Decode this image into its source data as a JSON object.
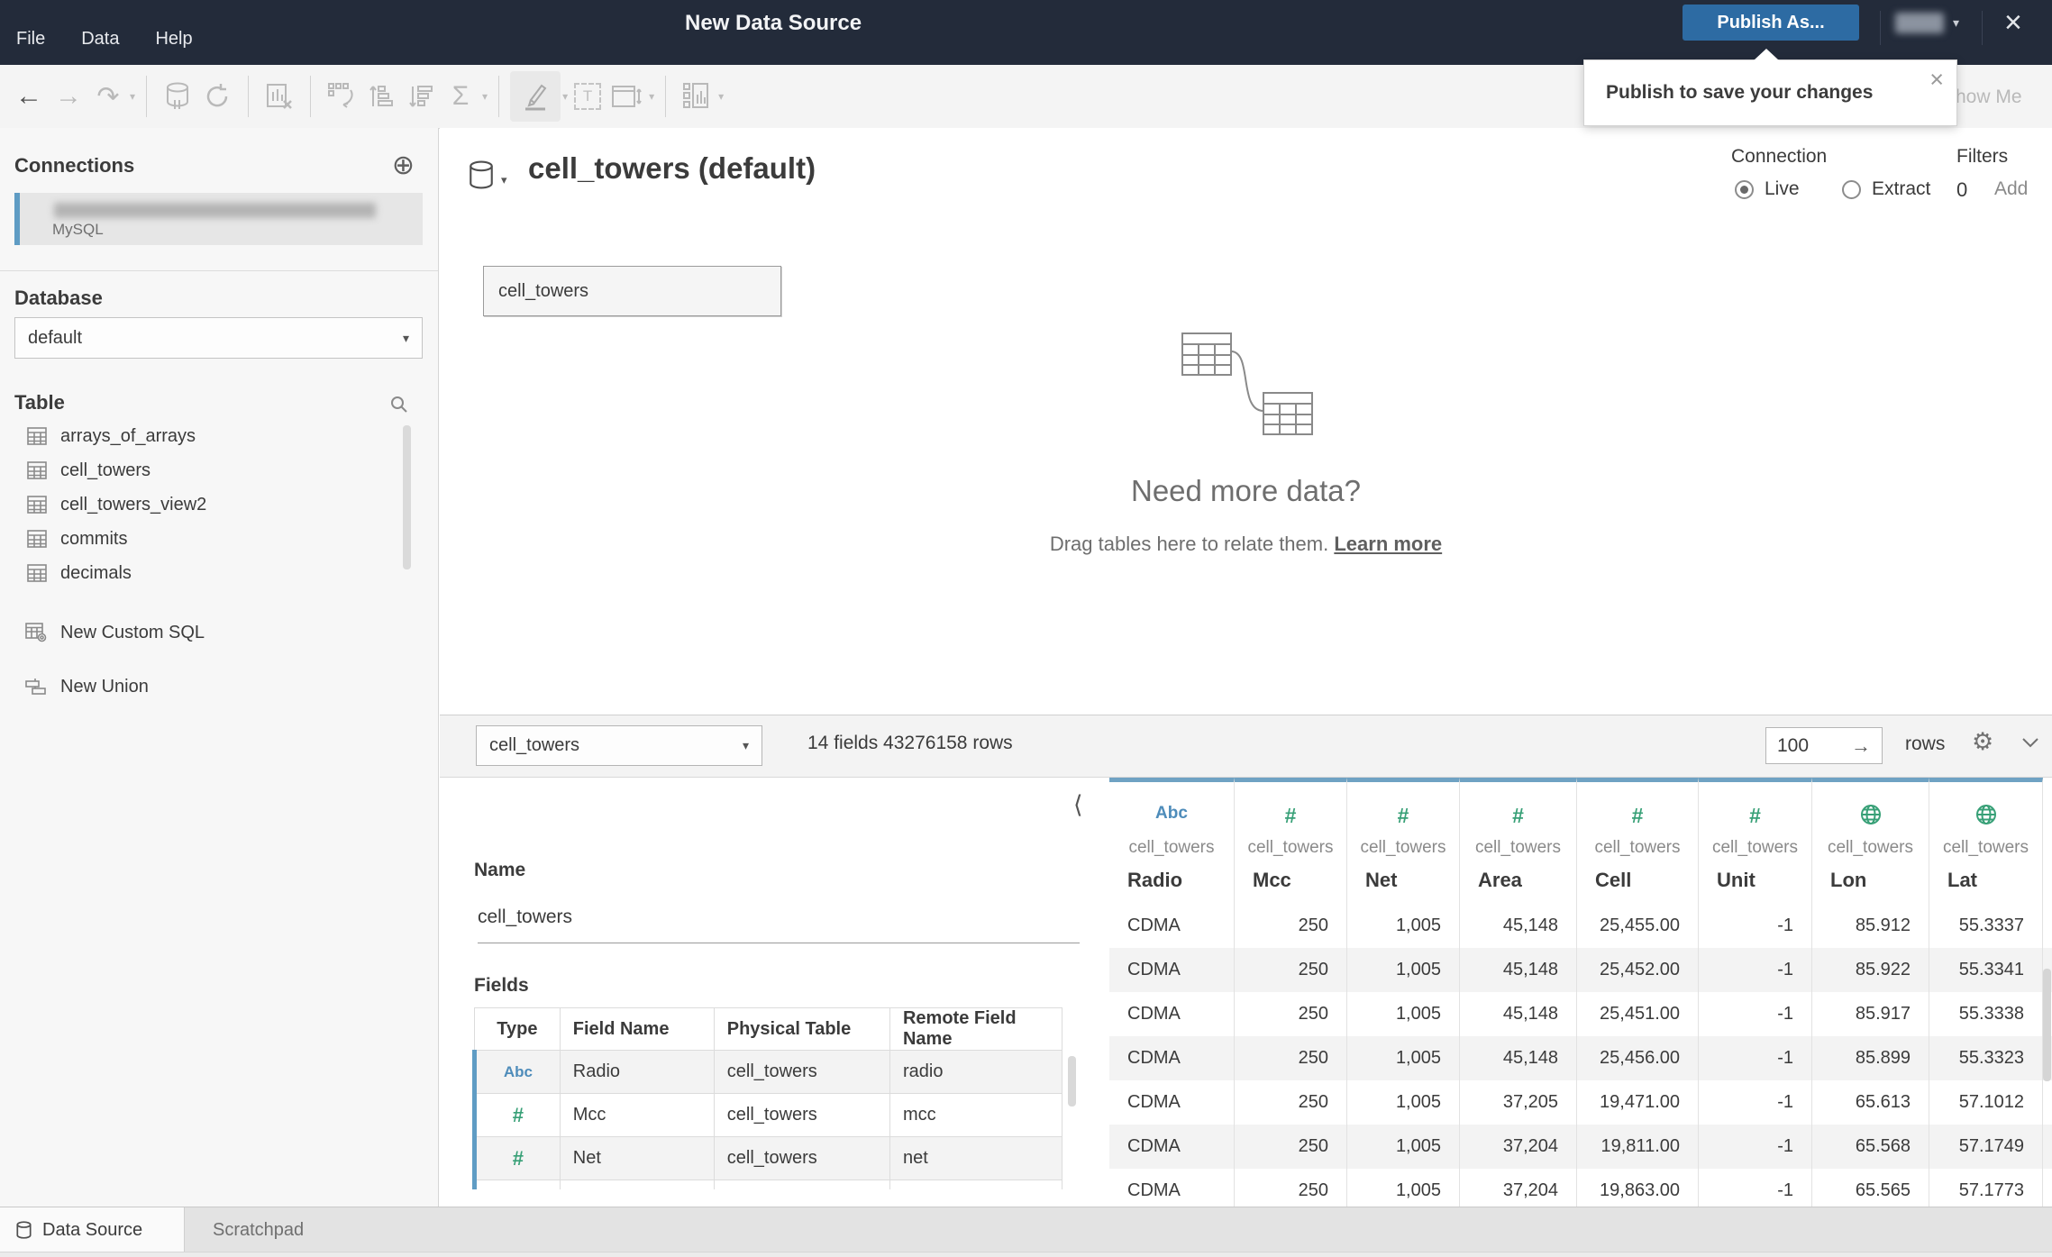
{
  "topbar": {
    "menus": [
      "File",
      "Data",
      "Help"
    ],
    "title": "New Data Source",
    "publish_label": "Publish As...",
    "close": "×"
  },
  "tooltip": {
    "text": "Publish to save your changes",
    "close": "×"
  },
  "toolbar": {
    "show_me": "Show Me"
  },
  "icons": {
    "back": "←",
    "forward": "→",
    "redo": "↷",
    "caret": "▾",
    "sigma": "Σ",
    "plus": "⊕",
    "gear": "⚙",
    "arrow_right": "→",
    "chevron_left": "⟨",
    "text_tool": "T"
  },
  "sidebar": {
    "connections_title": "Connections",
    "connection": {
      "type": "MySQL"
    },
    "database_label": "Database",
    "database_value": "default",
    "table_label": "Table",
    "tables": [
      "arrays_of_arrays",
      "cell_towers",
      "cell_towers_view2",
      "commits",
      "decimals"
    ],
    "actions": [
      {
        "label": "New Custom SQL"
      },
      {
        "label": "New Union"
      }
    ]
  },
  "canvas": {
    "title": "cell_towers (default)",
    "node_label": "cell_towers",
    "connection_label": "Connection",
    "live_label": "Live",
    "extract_label": "Extract",
    "filters_label": "Filters",
    "filters_count": "0",
    "add_label": "Add",
    "empty_heading": "Need more data?",
    "empty_text": "Drag tables here to relate them.",
    "empty_link": "Learn more"
  },
  "details": {
    "table_select": "cell_towers",
    "meta": "14 fields 43276158 rows",
    "rows_value": "100",
    "rows_label": "rows",
    "name_label": "Name",
    "name_value": "cell_towers",
    "fields_label": "Fields",
    "fields_headers": [
      "Type",
      "Field Name",
      "Physical Table",
      "Remote Field Name"
    ],
    "fields_rows": [
      {
        "type": "Abc",
        "name": "Radio",
        "physical": "cell_towers",
        "remote": "radio"
      },
      {
        "type": "#",
        "name": "Mcc",
        "physical": "cell_towers",
        "remote": "mcc"
      },
      {
        "type": "#",
        "name": "Net",
        "physical": "cell_towers",
        "remote": "net"
      }
    ]
  },
  "grid": {
    "columns": [
      {
        "icon": "Abc",
        "table": "cell_towers",
        "name": "Radio"
      },
      {
        "icon": "#",
        "table": "cell_towers",
        "name": "Mcc"
      },
      {
        "icon": "#",
        "table": "cell_towers",
        "name": "Net"
      },
      {
        "icon": "#",
        "table": "cell_towers",
        "name": "Area"
      },
      {
        "icon": "#",
        "table": "cell_towers",
        "name": "Cell"
      },
      {
        "icon": "#",
        "table": "cell_towers",
        "name": "Unit"
      },
      {
        "icon": "globe",
        "table": "cell_towers",
        "name": "Lon"
      },
      {
        "icon": "globe",
        "table": "cell_towers",
        "name": "Lat"
      }
    ],
    "rows": [
      [
        "CDMA",
        "250",
        "1,005",
        "45,148",
        "25,455.00",
        "-1",
        "85.912",
        "55.3337"
      ],
      [
        "CDMA",
        "250",
        "1,005",
        "45,148",
        "25,452.00",
        "-1",
        "85.922",
        "55.3341"
      ],
      [
        "CDMA",
        "250",
        "1,005",
        "45,148",
        "25,451.00",
        "-1",
        "85.917",
        "55.3338"
      ],
      [
        "CDMA",
        "250",
        "1,005",
        "45,148",
        "25,456.00",
        "-1",
        "85.899",
        "55.3323"
      ],
      [
        "CDMA",
        "250",
        "1,005",
        "37,205",
        "19,471.00",
        "-1",
        "65.613",
        "57.1012"
      ],
      [
        "CDMA",
        "250",
        "1,005",
        "37,204",
        "19,811.00",
        "-1",
        "65.568",
        "57.1749"
      ],
      [
        "CDMA",
        "250",
        "1,005",
        "37,204",
        "19,863.00",
        "-1",
        "65.565",
        "57.1773"
      ]
    ]
  },
  "tabs": {
    "data_source": "Data Source",
    "scratchpad": "Scratchpad"
  },
  "colors": {
    "topbar": "#232b3a",
    "publish_blue": "#2d6ba3",
    "header_strip_blue": "#6fa2c3",
    "accent_bar_blue": "#5f9cc4",
    "dimension_blue": "#4e8cba",
    "measure_green": "#38a077"
  }
}
